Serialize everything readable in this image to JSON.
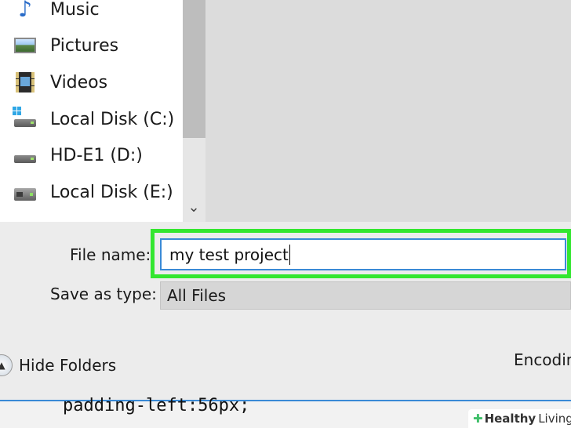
{
  "navigation": {
    "items": [
      {
        "label": "Music",
        "icon": "music-note-icon"
      },
      {
        "label": "Pictures",
        "icon": "pictures-icon"
      },
      {
        "label": "Videos",
        "icon": "videos-icon"
      },
      {
        "label": "Local Disk (C:)",
        "icon": "windows-disk-icon"
      },
      {
        "label": "HD-E1 (D:)",
        "icon": "drive-icon"
      },
      {
        "label": "Local Disk (E:)",
        "icon": "external-drive-icon"
      }
    ],
    "scroll_down_icon": "chevron-down-icon"
  },
  "form": {
    "file_name_label": "File name:",
    "file_name_value": "my test project",
    "save_as_type_label": "Save as type:",
    "save_as_type_value": "All Files"
  },
  "footer": {
    "hide_folders_label": "Hide Folders",
    "encoding_label": "Encodin"
  },
  "background_code": {
    "line": "padding-left:56px;"
  },
  "watermark": {
    "brand_bold": "Healthy",
    "brand_light": "Living"
  },
  "colors": {
    "highlight": "#33e62f",
    "input_border": "#3a8ad6"
  }
}
